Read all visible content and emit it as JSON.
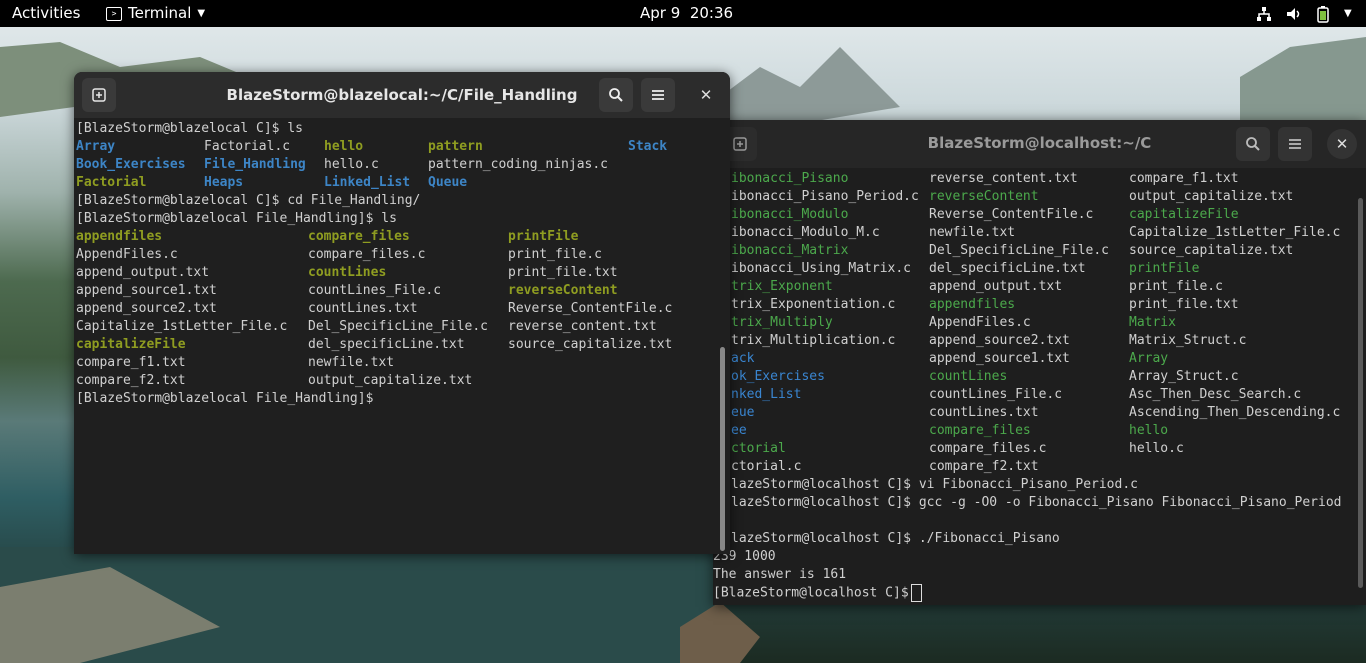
{
  "topbar": {
    "activities": "Activities",
    "app_name": "Terminal",
    "date": "Apr 9",
    "time": "20:36"
  },
  "window_left": {
    "title": "BlazeStorm@blazelocal:~/C/File_Handling",
    "lines": [
      {
        "text": "[BlazeStorm@blazelocal C]$ ls"
      },
      {
        "cells": [
          {
            "t": "Array",
            "s": "dir"
          },
          {
            "t": "Factorial.c",
            "s": "txt"
          },
          {
            "t": "hello",
            "s": "grn"
          },
          {
            "t": "pattern",
            "s": "grn"
          },
          {
            "t": "Stack",
            "s": "dir"
          }
        ]
      },
      {
        "cells": [
          {
            "t": "Book_Exercises",
            "s": "dir"
          },
          {
            "t": "File_Handling",
            "s": "dir"
          },
          {
            "t": "hello.c",
            "s": "txt"
          },
          {
            "t": "pattern_coding_ninjas.c",
            "s": "txt"
          }
        ]
      },
      {
        "cells": [
          {
            "t": "Factorial",
            "s": "grn"
          },
          {
            "t": "Heaps",
            "s": "dir"
          },
          {
            "t": "Linked_List",
            "s": "dir"
          },
          {
            "t": "Queue",
            "s": "dir"
          }
        ]
      },
      {
        "text": "[BlazeStorm@blazelocal C]$ cd File_Handling/"
      },
      {
        "text": "[BlazeStorm@blazelocal File_Handling]$ ls"
      },
      {
        "cells": [
          {
            "t": "appendfiles",
            "s": "grn"
          },
          {
            "t": "compare_files",
            "s": "grn"
          },
          {
            "t": "printFile",
            "s": "grn"
          }
        ]
      },
      {
        "cells": [
          {
            "t": "AppendFiles.c",
            "s": "txt"
          },
          {
            "t": "compare_files.c",
            "s": "txt"
          },
          {
            "t": "print_file.c",
            "s": "txt"
          }
        ]
      },
      {
        "cells": [
          {
            "t": "append_output.txt",
            "s": "txt"
          },
          {
            "t": "countLines",
            "s": "grn"
          },
          {
            "t": "print_file.txt",
            "s": "txt"
          }
        ]
      },
      {
        "cells": [
          {
            "t": "append_source1.txt",
            "s": "txt"
          },
          {
            "t": "countLines_File.c",
            "s": "txt"
          },
          {
            "t": "reverseContent",
            "s": "grn"
          }
        ]
      },
      {
        "cells": [
          {
            "t": "append_source2.txt",
            "s": "txt"
          },
          {
            "t": "countLines.txt",
            "s": "txt"
          },
          {
            "t": "Reverse_ContentFile.c",
            "s": "txt"
          }
        ]
      },
      {
        "cells": [
          {
            "t": "Capitalize_1stLetter_File.c",
            "s": "txt"
          },
          {
            "t": "Del_SpecificLine_File.c",
            "s": "txt"
          },
          {
            "t": "reverse_content.txt",
            "s": "txt"
          }
        ]
      },
      {
        "cells": [
          {
            "t": "capitalizeFile",
            "s": "grn"
          },
          {
            "t": "del_specificLine.txt",
            "s": "txt"
          },
          {
            "t": "source_capitalize.txt",
            "s": "txt"
          }
        ]
      },
      {
        "cells": [
          {
            "t": "compare_f1.txt",
            "s": "txt"
          },
          {
            "t": "newfile.txt",
            "s": "txt"
          }
        ]
      },
      {
        "cells": [
          {
            "t": "compare_f2.txt",
            "s": "txt"
          },
          {
            "t": "output_capitalize.txt",
            "s": "txt"
          }
        ]
      },
      {
        "text": "[BlazeStorm@blazelocal File_Handling]$"
      }
    ]
  },
  "window_right": {
    "title": "BlazeStorm@localhost:~/C",
    "rows": [
      [
        {
          "t": "ibonacci_Pisano",
          "s": "grn2"
        },
        {
          "t": "reverse_content.txt",
          "s": "txt"
        },
        {
          "t": "compare_f1.txt",
          "s": "txt"
        }
      ],
      [
        {
          "t": "ibonacci_Pisano_Period.c",
          "s": "txt"
        },
        {
          "t": "reverseContent",
          "s": "grn2"
        },
        {
          "t": "output_capitalize.txt",
          "s": "txt"
        }
      ],
      [
        {
          "t": "ibonacci_Modulo",
          "s": "grn2"
        },
        {
          "t": "Reverse_ContentFile.c",
          "s": "txt"
        },
        {
          "t": "capitalizeFile",
          "s": "grn2"
        }
      ],
      [
        {
          "t": "ibonacci_Modulo_M.c",
          "s": "txt"
        },
        {
          "t": "newfile.txt",
          "s": "txt"
        },
        {
          "t": "Capitalize_1stLetter_File.c",
          "s": "txt"
        }
      ],
      [
        {
          "t": "ibonacci_Matrix",
          "s": "grn2"
        },
        {
          "t": "Del_SpecificLine_File.c",
          "s": "txt"
        },
        {
          "t": "source_capitalize.txt",
          "s": "txt"
        }
      ],
      [
        {
          "t": "ibonacci_Using_Matrix.c",
          "s": "txt"
        },
        {
          "t": "del_specificLine.txt",
          "s": "txt"
        },
        {
          "t": "printFile",
          "s": "grn2"
        }
      ],
      [
        {
          "t": "trix_Exponent",
          "s": "grn2"
        },
        {
          "t": "append_output.txt",
          "s": "txt"
        },
        {
          "t": "print_file.c",
          "s": "txt"
        }
      ],
      [
        {
          "t": "trix_Exponentiation.c",
          "s": "txt"
        },
        {
          "t": "appendfiles",
          "s": "grn2"
        },
        {
          "t": "print_file.txt",
          "s": "txt"
        }
      ],
      [
        {
          "t": "trix_Multiply",
          "s": "grn2"
        },
        {
          "t": "AppendFiles.c",
          "s": "txt"
        },
        {
          "t": "Matrix",
          "s": "grn2"
        }
      ],
      [
        {
          "t": "trix_Multiplication.c",
          "s": "txt"
        },
        {
          "t": "append_source2.txt",
          "s": "txt"
        },
        {
          "t": "Matrix_Struct.c",
          "s": "txt"
        }
      ],
      [
        {
          "t": "ack",
          "s": "blu2"
        },
        {
          "t": "append_source1.txt",
          "s": "txt"
        },
        {
          "t": "Array",
          "s": "grn2"
        }
      ],
      [
        {
          "t": "ok_Exercises",
          "s": "blu2"
        },
        {
          "t": "countLines",
          "s": "grn2"
        },
        {
          "t": "Array_Struct.c",
          "s": "txt"
        }
      ],
      [
        {
          "t": "nked_List",
          "s": "blu2"
        },
        {
          "t": "countLines_File.c",
          "s": "txt"
        },
        {
          "t": "Asc_Then_Desc_Search.c",
          "s": "txt"
        }
      ],
      [
        {
          "t": "eue",
          "s": "blu2"
        },
        {
          "t": "countLines.txt",
          "s": "txt"
        },
        {
          "t": "Ascending_Then_Descending.c",
          "s": "txt"
        }
      ],
      [
        {
          "t": "ee",
          "s": "blu2"
        },
        {
          "t": "compare_files",
          "s": "grn2"
        },
        {
          "t": "hello",
          "s": "grn2"
        }
      ],
      [
        {
          "t": "ctorial",
          "s": "grn2"
        },
        {
          "t": "compare_files.c",
          "s": "txt"
        },
        {
          "t": "hello.c",
          "s": "txt"
        }
      ],
      [
        {
          "t": "ctorial.c",
          "s": "txt"
        },
        {
          "t": "compare_f2.txt",
          "s": "txt"
        }
      ]
    ],
    "tail": [
      "lazeStorm@localhost C]$ vi Fibonacci_Pisano_Period.c",
      "lazeStorm@localhost C]$ gcc -g -O0 -o Fibonacci_Pisano Fibonacci_Pisano_Period",
      "",
      "lazeStorm@localhost C]$ ./Fibonacci_Pisano",
      "239 1000",
      "The answer is 161",
      "[BlazeStorm@localhost C]$"
    ]
  }
}
